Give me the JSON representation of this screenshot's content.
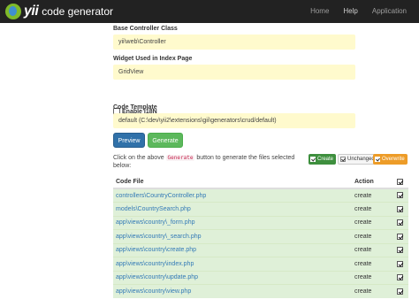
{
  "navbar": {
    "brand_logo_text": "yii",
    "brand_text": "code generator",
    "links": [
      "Home",
      "Help",
      "Application"
    ]
  },
  "form": {
    "base_controller_label": "Base Controller Class",
    "base_controller_value": "yii\\web\\Controller",
    "widget_label": "Widget Used in Index Page",
    "widget_value": "GridView",
    "i18n_label": "Enable I18N",
    "i18n_checked": false,
    "code_template_label": "Code Template",
    "code_template_value": "default (C:\\dev\\yii2\\extensions\\gii\\generators\\crud/default)"
  },
  "buttons": {
    "preview": "Preview",
    "generate": "Generate"
  },
  "help": {
    "before": "Click on the above ",
    "code": "Generate",
    "after": " button to generate the files selected below:"
  },
  "legend": {
    "create": "Create",
    "unchanged": "Unchanged",
    "overwrite": "Overwrite"
  },
  "table": {
    "headers": {
      "file": "Code File",
      "action": "Action"
    },
    "rows": [
      {
        "file": "controllers\\CountryController.php",
        "action": "create"
      },
      {
        "file": "models\\CountrySearch.php",
        "action": "create"
      },
      {
        "file": "app\\views\\country\\_form.php",
        "action": "create"
      },
      {
        "file": "app\\views\\country\\_search.php",
        "action": "create"
      },
      {
        "file": "app\\views\\country\\create.php",
        "action": "create"
      },
      {
        "file": "app\\views\\country\\index.php",
        "action": "create"
      },
      {
        "file": "app\\views\\country\\update.php",
        "action": "create"
      },
      {
        "file": "app\\views\\country\\view.php",
        "action": "create"
      }
    ]
  },
  "colors": {
    "navbar_bg": "#222222",
    "field_bg": "#fffacd",
    "row_create_bg": "#dff0d8",
    "preview_btn": "#3071a9",
    "generate_btn": "#5cb85c",
    "legend_create": "#3e8f3e",
    "legend_overwrite": "#ed9c28"
  }
}
